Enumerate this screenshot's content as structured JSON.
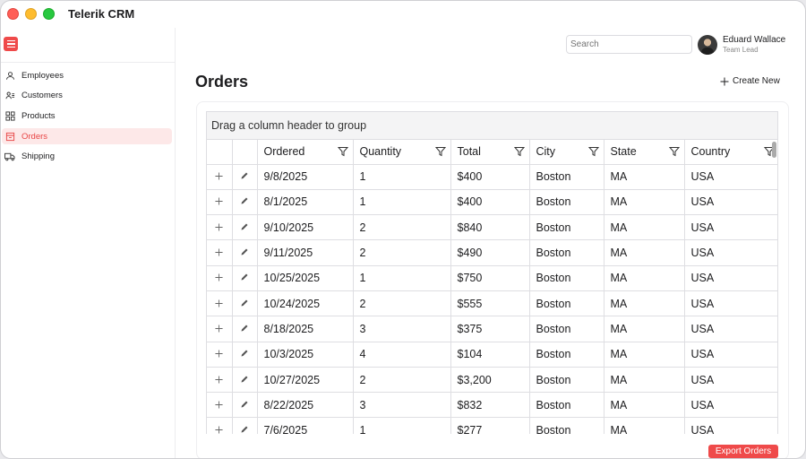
{
  "app": {
    "title": "Telerik CRM"
  },
  "sidebar": {
    "items": [
      {
        "label": "Employees",
        "icon": "employees-icon",
        "active": false
      },
      {
        "label": "Customers",
        "icon": "customers-icon",
        "active": false
      },
      {
        "label": "Products",
        "icon": "products-icon",
        "active": false
      },
      {
        "label": "Orders",
        "icon": "orders-icon",
        "active": true
      },
      {
        "label": "Shipping",
        "icon": "shipping-icon",
        "active": false
      }
    ]
  },
  "header": {
    "search_placeholder": "Search",
    "user": {
      "name": "Eduard Wallace",
      "role": "Team Lead"
    }
  },
  "main": {
    "title": "Orders",
    "create_label": "Create New",
    "export_label": "Export Orders"
  },
  "grid": {
    "group_hint": "Drag a column header to group",
    "columns": [
      "Ordered",
      "Quantity",
      "Total",
      "City",
      "State",
      "Country"
    ],
    "rows": [
      [
        "9/8/2025",
        "1",
        "$400",
        "Boston",
        "MA",
        "USA"
      ],
      [
        "8/1/2025",
        "1",
        "$400",
        "Boston",
        "MA",
        "USA"
      ],
      [
        "9/10/2025",
        "2",
        "$840",
        "Boston",
        "MA",
        "USA"
      ],
      [
        "9/11/2025",
        "2",
        "$490",
        "Boston",
        "MA",
        "USA"
      ],
      [
        "10/25/2025",
        "1",
        "$750",
        "Boston",
        "MA",
        "USA"
      ],
      [
        "10/24/2025",
        "2",
        "$555",
        "Boston",
        "MA",
        "USA"
      ],
      [
        "8/18/2025",
        "3",
        "$375",
        "Boston",
        "MA",
        "USA"
      ],
      [
        "10/3/2025",
        "4",
        "$104",
        "Boston",
        "MA",
        "USA"
      ],
      [
        "10/27/2025",
        "2",
        "$3,200",
        "Boston",
        "MA",
        "USA"
      ],
      [
        "8/22/2025",
        "3",
        "$832",
        "Boston",
        "MA",
        "USA"
      ],
      [
        "7/6/2025",
        "1",
        "$277",
        "Boston",
        "MA",
        "USA"
      ]
    ]
  },
  "colors": {
    "accent": "#ef4a4a",
    "active_bg": "#fde8e8"
  }
}
